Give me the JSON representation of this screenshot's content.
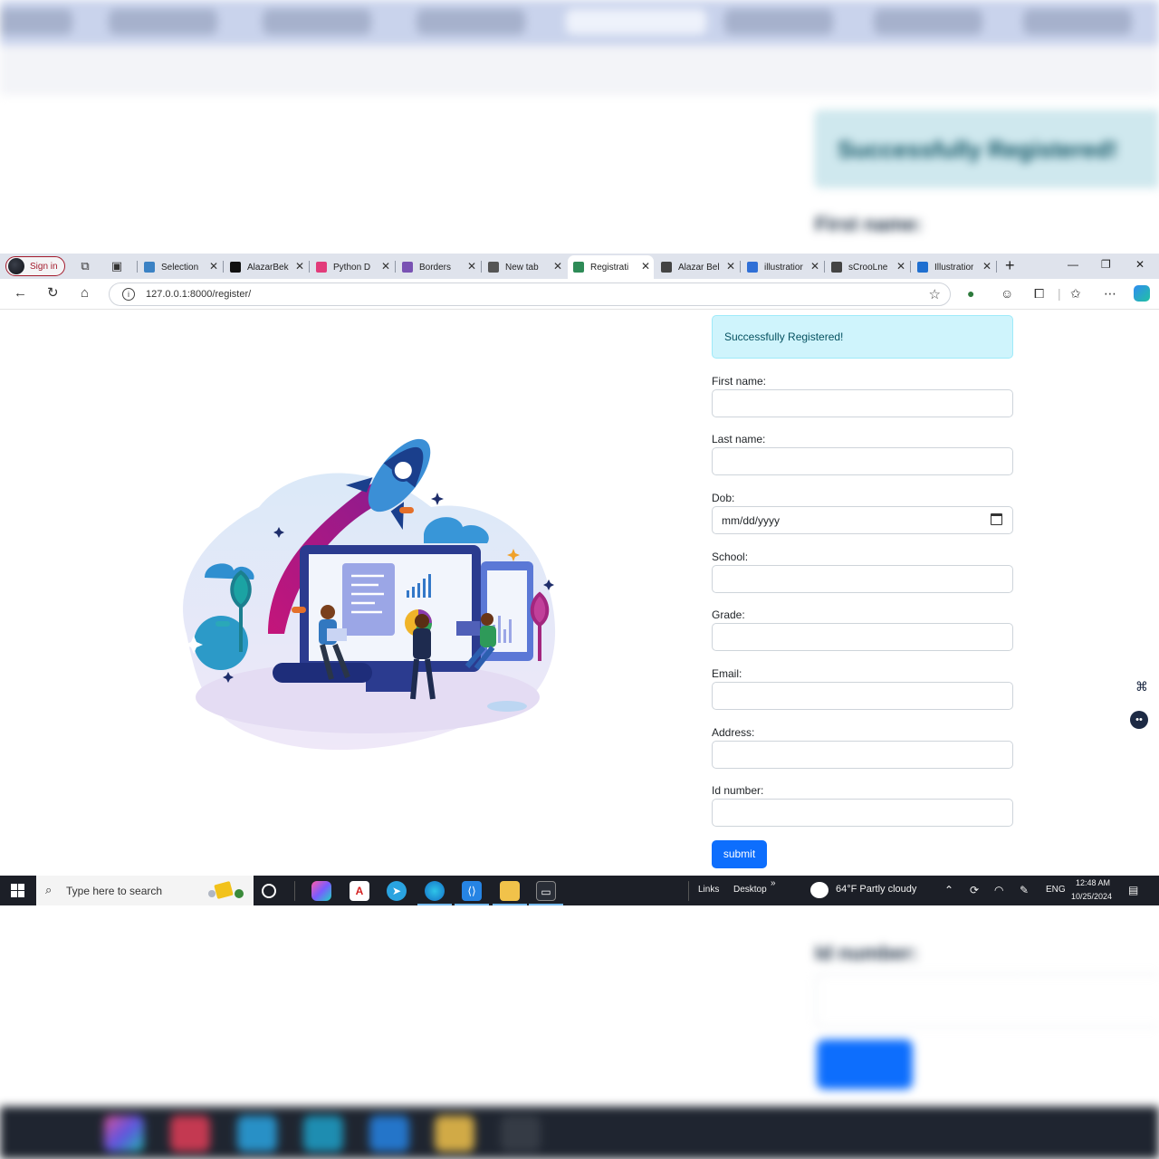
{
  "browser": {
    "profile_label": "Sign in",
    "tabs": [
      {
        "title": "Selection",
        "favicon_color": "#3b82c4"
      },
      {
        "title": "AlazarBek",
        "favicon_color": "#111111"
      },
      {
        "title": "Python D",
        "favicon_color": "#e23c7a"
      },
      {
        "title": "Borders",
        "favicon_color": "#7952b3"
      },
      {
        "title": "New tab",
        "favicon_color": "#555555"
      },
      {
        "title": "Registrati",
        "favicon_color": "#2e8b57"
      },
      {
        "title": "Alazar Bel",
        "favicon_color": "#444444"
      },
      {
        "title": "illustratior",
        "favicon_color": "#2f6fd6"
      },
      {
        "title": "sCrooLne",
        "favicon_color": "#444444"
      },
      {
        "title": "Illustratior",
        "favicon_color": "#1f6fd0"
      }
    ],
    "active_tab_index": 5,
    "url": "127.0.0.1:8000/register/"
  },
  "page": {
    "alert_text": "Successfully Registered!",
    "fields": [
      {
        "label": "First name:",
        "value": ""
      },
      {
        "label": "Last name:",
        "value": ""
      },
      {
        "label": "Dob:",
        "value": "mm/dd/yyyy"
      },
      {
        "label": "School:",
        "value": ""
      },
      {
        "label": "Grade:",
        "value": ""
      },
      {
        "label": "Email:",
        "value": ""
      },
      {
        "label": "Address:",
        "value": ""
      },
      {
        "label": "Id number:",
        "value": ""
      }
    ],
    "submit_label": "submit"
  },
  "taskbar": {
    "search_placeholder": "Type here to search",
    "toolbar_links": "Links",
    "toolbar_desktop": "Desktop",
    "weather": "64°F  Partly cloudy",
    "language": "ENG",
    "time": "12:48 AM",
    "date": "10/25/2024"
  },
  "icons": [
    "rocket-illustration",
    "calendar-icon",
    "search-icon",
    "star-icon",
    "home-icon",
    "refresh-icon",
    "back-icon",
    "close-icon"
  ]
}
